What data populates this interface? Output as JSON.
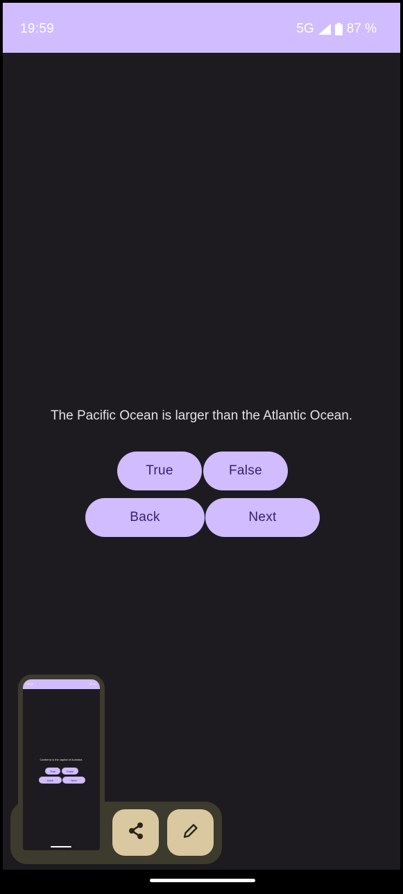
{
  "status_bar": {
    "time": "19:59",
    "network": "5G",
    "battery": "87 %"
  },
  "quiz": {
    "question": "The Pacific Ocean is larger than the Atlantic Ocean.",
    "true_label": "True",
    "false_label": "False",
    "back_label": "Back",
    "next_label": "Next"
  },
  "screenshot_preview": {
    "question": "Canberra is the capital of Australia.",
    "true_label": "True",
    "false_label": "False",
    "back_label": "Back",
    "next_label": "Next"
  },
  "colors": {
    "accent": "#d0bcfe",
    "on_accent": "#381e72",
    "background": "#1d1b20",
    "action_button": "#d9c8a0"
  },
  "icons": {
    "share": "share-icon",
    "edit": "pencil-icon",
    "signal": "signal-icon",
    "battery": "battery-icon"
  }
}
